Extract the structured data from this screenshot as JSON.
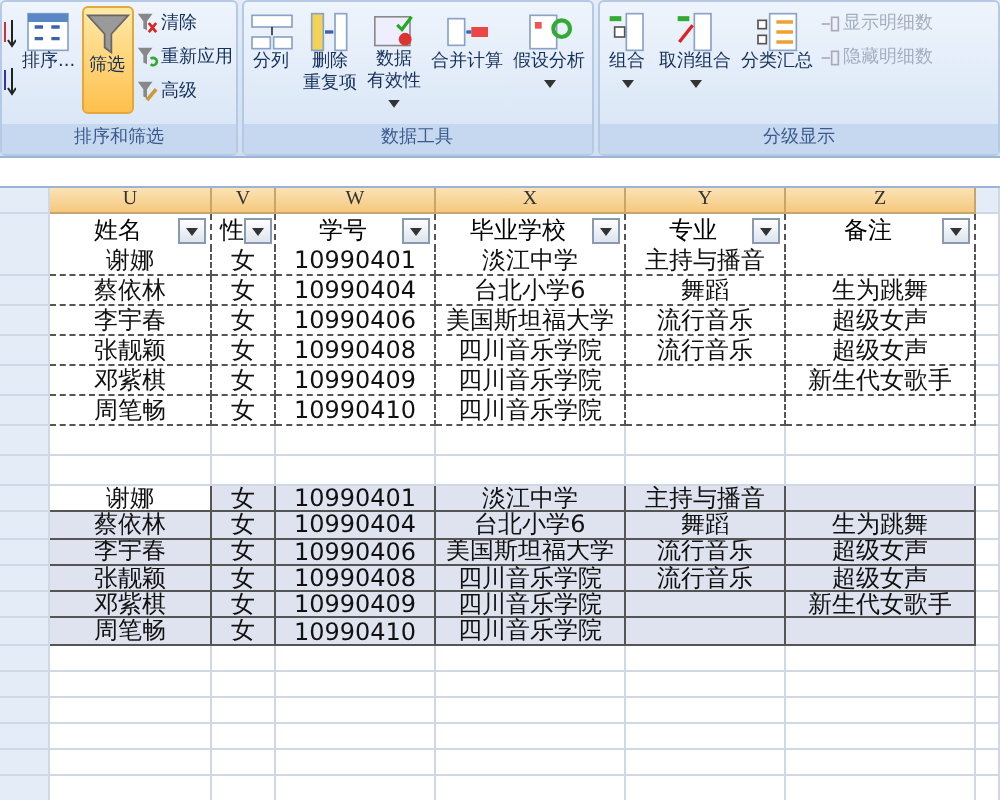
{
  "ribbon": {
    "groups": [
      {
        "label": "排序和筛选",
        "items": [
          {
            "kind": "edge"
          },
          {
            "kind": "large",
            "lines": [
              "排序..."
            ],
            "selected": false,
            "dropdown": false
          },
          {
            "kind": "large",
            "lines": [
              "筛选"
            ],
            "selected": true,
            "dropdown": false
          },
          {
            "kind": "small",
            "label": "清除",
            "disabled": false
          },
          {
            "kind": "small",
            "label": "重新应用",
            "disabled": false
          },
          {
            "kind": "small",
            "label": "高级",
            "disabled": false
          }
        ]
      },
      {
        "label": "数据工具",
        "items": [
          {
            "kind": "large",
            "lines": [
              "分列"
            ],
            "selected": false,
            "dropdown": false
          },
          {
            "kind": "large",
            "lines": [
              "删除",
              "重复项"
            ],
            "selected": false,
            "dropdown": false
          },
          {
            "kind": "large",
            "lines": [
              "数据",
              "有效性"
            ],
            "selected": false,
            "dropdown": true
          },
          {
            "kind": "large",
            "lines": [
              "合并计算"
            ],
            "selected": false,
            "dropdown": false
          },
          {
            "kind": "large",
            "lines": [
              "假设分析"
            ],
            "selected": false,
            "dropdown": true
          }
        ]
      },
      {
        "label": "分级显示",
        "items": [
          {
            "kind": "large",
            "lines": [
              "组合"
            ],
            "selected": false,
            "dropdown": true
          },
          {
            "kind": "large",
            "lines": [
              "取消组合"
            ],
            "selected": false,
            "dropdown": true
          },
          {
            "kind": "large",
            "lines": [
              "分类汇总"
            ],
            "selected": false,
            "dropdown": false
          },
          {
            "kind": "small",
            "label": "显示明细数",
            "disabled": true
          },
          {
            "kind": "small",
            "label": "隐藏明细数",
            "disabled": true
          }
        ]
      }
    ]
  },
  "sheet": {
    "columns": [
      "U",
      "V",
      "W",
      "X",
      "Y",
      "Z"
    ],
    "headers": [
      "姓名",
      "性",
      "学号",
      "毕业学校",
      "专业",
      "备注"
    ],
    "copied_table": {
      "copied": true,
      "rows": [
        {
          "name": "谢娜",
          "gender": "女",
          "id": "10990401",
          "school": "淡江中学",
          "major": "主持与播音"
        },
        {
          "name": "蔡依林",
          "gender": "女",
          "id": "10990404",
          "school": "台北小学6",
          "major": "舞蹈",
          "note": "生为跳舞"
        },
        {
          "name": "李宇春",
          "gender": "女",
          "id": "10990406",
          "school": "美国斯坦福大学",
          "major": "流行音乐",
          "note": "超级女声"
        },
        {
          "name": "张靓颖",
          "gender": "女",
          "id": "10990408",
          "school": "四川音乐学院",
          "major": "流行音乐",
          "note": "超级女声"
        },
        {
          "name": "邓紫棋",
          "gender": "女",
          "id": "10990409",
          "school": "四川音乐学院",
          "note": "新生代女歌手"
        },
        {
          "name": "周笔畅",
          "gender": "女",
          "id": "10990410",
          "school": "四川音乐学院"
        }
      ]
    },
    "pasted_table": {
      "selected": true,
      "rows": [
        {
          "active": true,
          "name": "谢娜",
          "gender": "女",
          "id": "10990401",
          "school": "淡江中学",
          "major": "主持与播音"
        },
        {
          "active": false,
          "name": "蔡依林",
          "gender": "女",
          "id": "10990404",
          "school": "台北小学6",
          "major": "舞蹈",
          "note": "生为跳舞"
        },
        {
          "active": false,
          "name": "李宇春",
          "gender": "女",
          "id": "10990406",
          "school": "美国斯坦福大学",
          "major": "流行音乐",
          "note": "超级女声"
        },
        {
          "active": false,
          "name": "张靓颖",
          "gender": "女",
          "id": "10990408",
          "school": "四川音乐学院",
          "major": "流行音乐",
          "note": "超级女声"
        },
        {
          "active": false,
          "name": "邓紫棋",
          "gender": "女",
          "id": "10990409",
          "school": "四川音乐学院",
          "note": "新生代女歌手"
        },
        {
          "active": false,
          "name": "周笔畅",
          "gender": "女",
          "id": "10990410",
          "school": "四川音乐学院"
        }
      ]
    }
  }
}
